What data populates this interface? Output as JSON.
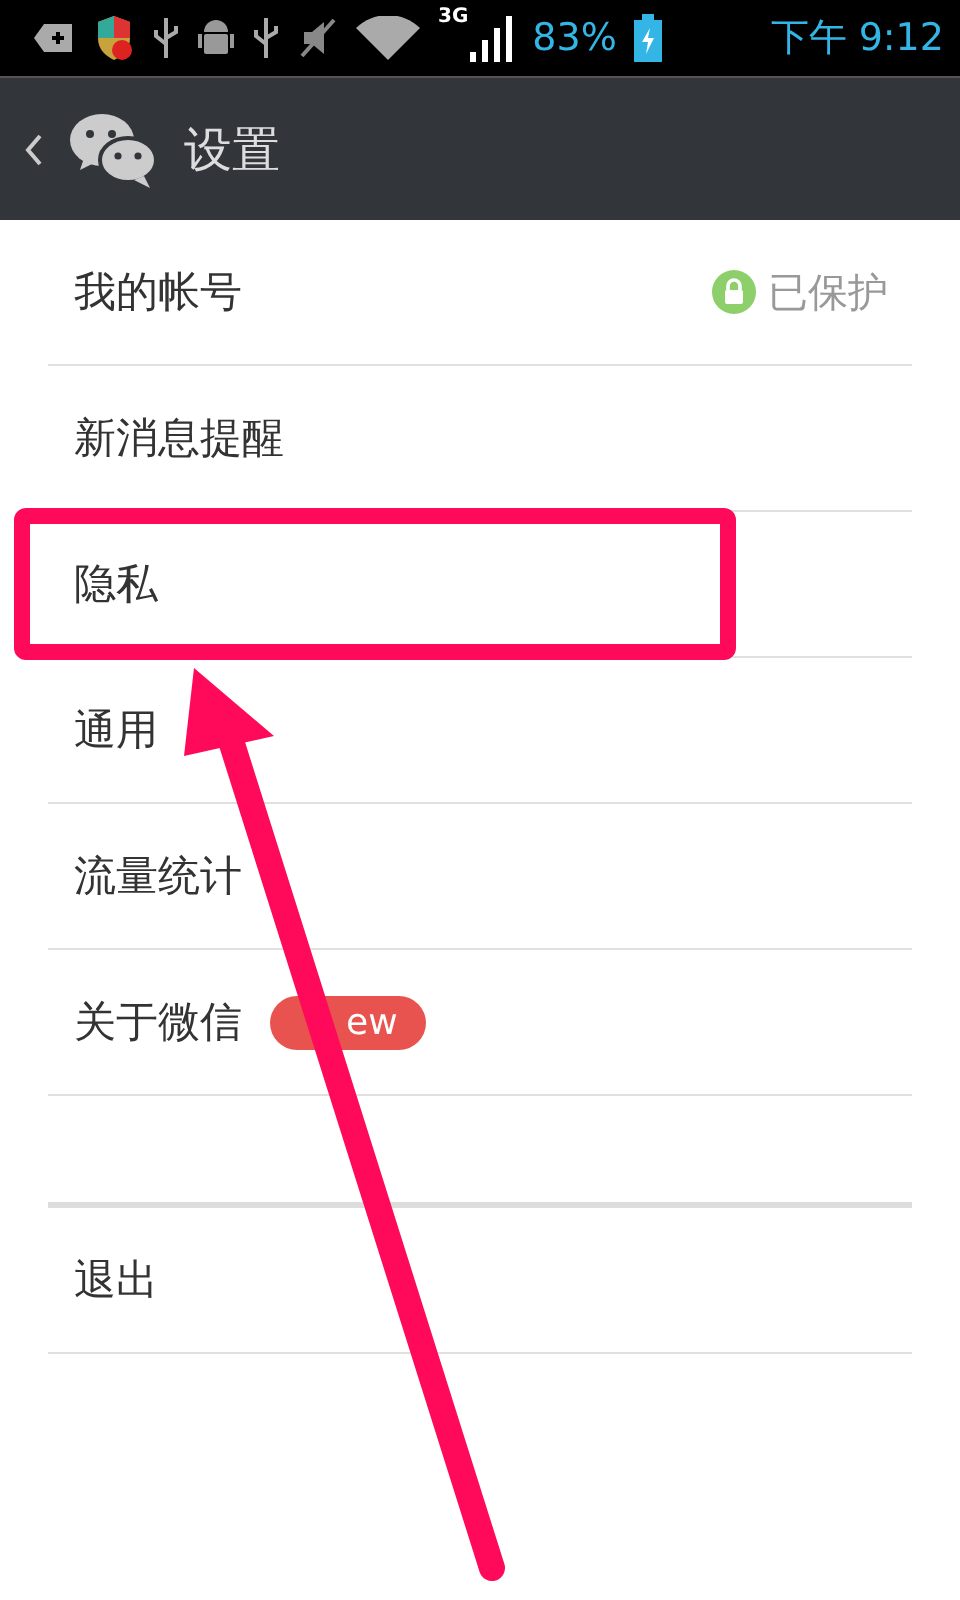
{
  "status_bar": {
    "network": "3G",
    "battery": "83%",
    "time": "下午 9:12"
  },
  "header": {
    "title": "设置"
  },
  "sections": [
    {
      "items": [
        {
          "label": "我的帐号",
          "highlighted": false,
          "status": "已保护"
        },
        {
          "label": "新消息提醒",
          "highlighted": false
        },
        {
          "label": "隐私",
          "highlighted": true
        },
        {
          "label": "通用",
          "highlighted": false
        },
        {
          "label": "流量统计",
          "highlighted": false
        },
        {
          "label": "关于微信",
          "highlighted": false,
          "badge": "ew"
        }
      ]
    },
    {
      "items": [
        {
          "label": "退出",
          "highlighted": false
        }
      ]
    }
  ]
}
